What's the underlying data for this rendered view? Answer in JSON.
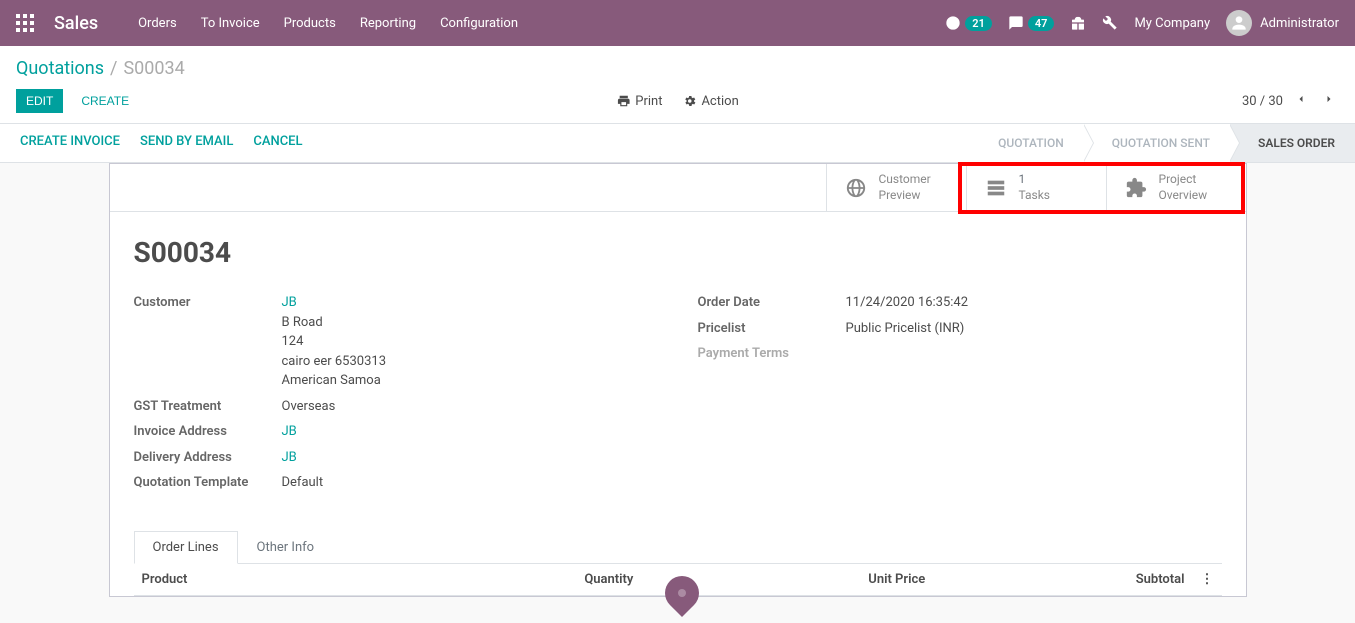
{
  "navbar": {
    "brand": "Sales",
    "menu": [
      "Orders",
      "To Invoice",
      "Products",
      "Reporting",
      "Configuration"
    ],
    "activities_count": "21",
    "messages_count": "47",
    "company": "My Company",
    "user": "Administrator"
  },
  "breadcrumb": {
    "parent": "Quotations",
    "current": "S00034"
  },
  "buttons": {
    "edit": "Edit",
    "create": "Create",
    "print": "Print",
    "action": "Action"
  },
  "pager": {
    "text": "30 / 30"
  },
  "status_actions": [
    "Create Invoice",
    "Send by Email",
    "Cancel"
  ],
  "status_steps": [
    {
      "label": "Quotation",
      "active": false
    },
    {
      "label": "Quotation Sent",
      "active": false
    },
    {
      "label": "Sales Order",
      "active": true
    }
  ],
  "stat_buttons": {
    "preview": {
      "line1": "Customer",
      "line2": "Preview"
    },
    "tasks": {
      "count": "1",
      "label": "Tasks"
    },
    "project": {
      "line1": "Project",
      "line2": "Overview"
    }
  },
  "record": {
    "title": "S00034"
  },
  "left_fields": {
    "customer_label": "Customer",
    "customer_name": "JB",
    "customer_addr1": "B Road",
    "customer_addr2": "124",
    "customer_addr3": "cairo eer 6530313",
    "customer_addr4": "American Samoa",
    "gst_label": "GST Treatment",
    "gst_value": "Overseas",
    "invoice_addr_label": "Invoice Address",
    "invoice_addr_value": "JB",
    "delivery_addr_label": "Delivery Address",
    "delivery_addr_value": "JB",
    "quote_tpl_label": "Quotation Template",
    "quote_tpl_value": "Default"
  },
  "right_fields": {
    "order_date_label": "Order Date",
    "order_date_value": "11/24/2020 16:35:42",
    "pricelist_label": "Pricelist",
    "pricelist_value": "Public Pricelist (INR)",
    "payment_terms_label": "Payment Terms",
    "payment_terms_value": ""
  },
  "tabs": {
    "order_lines": "Order Lines",
    "other_info": "Other Info"
  },
  "table": {
    "headers": {
      "product": "Product",
      "quantity": "Quantity",
      "unit_price": "Unit Price",
      "subtotal": "Subtotal"
    }
  }
}
